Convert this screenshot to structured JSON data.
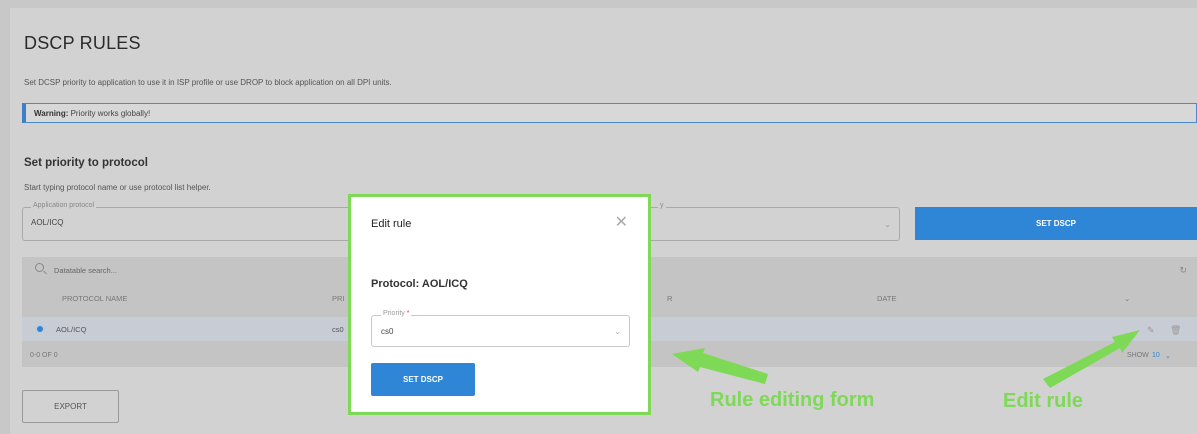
{
  "header": {
    "title": "DSCP RULES",
    "description": "Set DCSP priority to application to use it in ISP profile or use DROP to block application on all DPI units."
  },
  "warning": {
    "label": "Warning:",
    "text": " Priority works globally!"
  },
  "section": {
    "title": "Set priority to protocol",
    "description": "Start typing protocol name or use protocol list helper."
  },
  "form": {
    "app_protocol_label": "Application protocol",
    "app_protocol_value": "AOL/ICQ",
    "priority_label": "y",
    "set_button": "SET DSCP"
  },
  "table": {
    "search_placeholder": "Datatable search...",
    "columns": {
      "protocol": "PROTOCOL NAME",
      "priority": "PRI",
      "user": "R",
      "date": "DATE"
    },
    "rows": [
      {
        "protocol": "AOL/ICQ",
        "priority": "cs0"
      }
    ],
    "pagination": "0-0 OF 0",
    "show_label": "SHOW",
    "show_value": "10"
  },
  "export_button": "EXPORT",
  "modal": {
    "title": "Edit rule",
    "protocol_text": "Protocol: AOL/ICQ",
    "priority_label": "Priority",
    "required_mark": "*",
    "priority_value": "cs0",
    "button": "SET DSCP"
  },
  "annotations": {
    "form_label": "Rule editing form",
    "edit_label": "Edit rule"
  },
  "colors": {
    "accent": "#2f86d6",
    "highlight": "#7ed957",
    "warning_border": "#3f7fc8"
  },
  "icons": [
    "search-icon",
    "refresh-icon",
    "toggle-icon",
    "edit-icon",
    "delete-icon",
    "close-icon",
    "chevron-down-icon"
  ]
}
